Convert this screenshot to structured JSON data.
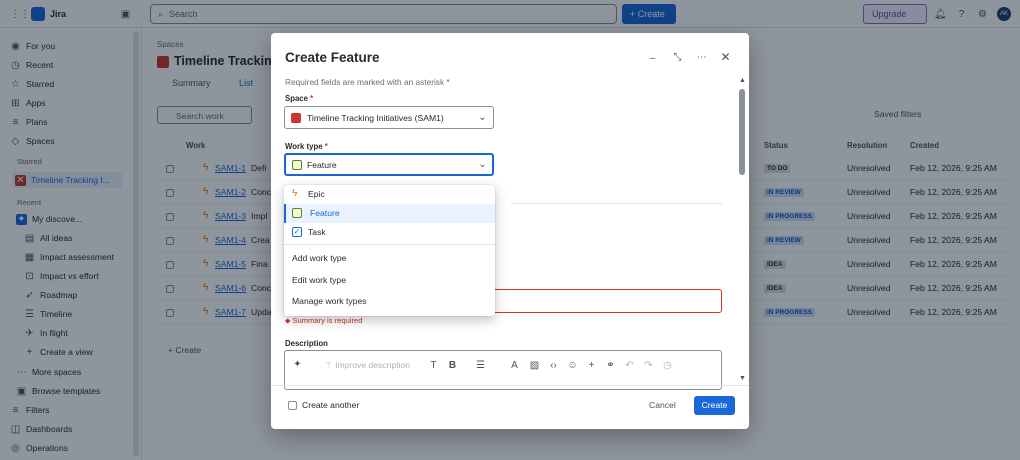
{
  "topbar": {
    "app_name": "Jira",
    "search_placeholder": "Search",
    "create_label": "+ Create",
    "upgrade_label": "Upgrade",
    "avatar_initials": "AK"
  },
  "sidebar": {
    "for_you": "For you",
    "recent": "Recent",
    "starred": "Starred",
    "apps": "Apps",
    "plans": "Plans",
    "spaces": "Spaces",
    "starred_section": "Starred",
    "starred_item": "Timeline Tracking I...",
    "recent_section": "Recent",
    "recent_item": "My discove...",
    "sub_items": [
      "All ideas",
      "Impact assessment",
      "Impact vs effort",
      "Roadmap",
      "Timeline",
      "In flight",
      "Create a view"
    ],
    "more_spaces": "More spaces",
    "browse_templates": "Browse templates",
    "filters": "Filters",
    "dashboards": "Dashboards",
    "operations": "Operations"
  },
  "page": {
    "breadcrumb": "Spaces",
    "title": "Timeline Tracking",
    "tabs": [
      "Summary",
      "List"
    ],
    "search_work": "Search work",
    "saved_filters": "Saved filters",
    "columns": {
      "work": "Work",
      "status": "Status",
      "resolution": "Resolution",
      "created": "Created"
    },
    "create_row": "+ Create",
    "rows": [
      {
        "key": "SAM1-1",
        "summary": "Defi",
        "status": "TO DO",
        "resolution": "Unresolved",
        "created": "Feb 12, 2026, 9:25 AM"
      },
      {
        "key": "SAM1-2",
        "summary": "Conc",
        "status": "IN REVIEW",
        "resolution": "Unresolved",
        "created": "Feb 12, 2026, 9:25 AM"
      },
      {
        "key": "SAM1-3",
        "summary": "Impl",
        "status": "IN PROGRESS",
        "resolution": "Unresolved",
        "created": "Feb 12, 2026, 9:25 AM"
      },
      {
        "key": "SAM1-4",
        "summary": "Crea",
        "status": "IN REVIEW",
        "resolution": "Unresolved",
        "created": "Feb 12, 2026, 9:25 AM"
      },
      {
        "key": "SAM1-5",
        "summary": "Fina",
        "status": "IDEA",
        "resolution": "Unresolved",
        "created": "Feb 12, 2026, 9:25 AM"
      },
      {
        "key": "SAM1-6",
        "summary": "Conc",
        "status": "IDEA",
        "resolution": "Unresolved",
        "created": "Feb 12, 2026, 9:25 AM"
      },
      {
        "key": "SAM1-7",
        "summary": "Upda",
        "status": "IN PROGRESS",
        "resolution": "Unresolved",
        "created": "Feb 12, 2026, 9:25 AM"
      }
    ]
  },
  "modal": {
    "title": "Create Feature",
    "required_note": "Required fields are marked with an asterisk",
    "space_label": "Space",
    "space_value": "Timeline Tracking Initiatives (SAM1)",
    "work_type_label": "Work type",
    "work_type_value": "Feature",
    "dropdown_options": [
      "Epic",
      "Feature",
      "Task"
    ],
    "dropdown_actions": [
      "Add work type",
      "Edit work type",
      "Manage work types"
    ],
    "summary_error": "Summary is required",
    "description_label": "Description",
    "improve_description": "Improve description",
    "create_another": "Create another",
    "cancel": "Cancel",
    "create": "Create"
  },
  "colors": {
    "primary": "#1868DB",
    "epic": "#E06C00",
    "feature": "#5B7F24",
    "task": "#1868DB",
    "error": "#C9372C"
  }
}
